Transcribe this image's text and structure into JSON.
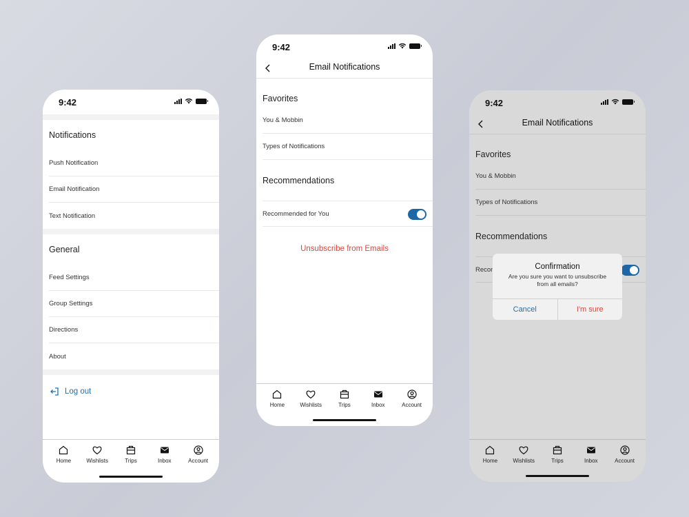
{
  "colors": {
    "accent": "#1d67a6",
    "danger": "#d6473d",
    "link": "#1e6fb0"
  },
  "status_time": "9:42",
  "tabs": [
    {
      "label": "Home",
      "icon": "home-icon"
    },
    {
      "label": "Wishlists",
      "icon": "heart-icon"
    },
    {
      "label": "Trips",
      "icon": "briefcase-icon"
    },
    {
      "label": "Inbox",
      "icon": "mail-icon"
    },
    {
      "label": "Account",
      "icon": "account-icon"
    }
  ],
  "settings": {
    "notifications_title": "Notifications",
    "notification_items": [
      "Push Notification",
      "Email Notification",
      "Text Notification"
    ],
    "general_title": "General",
    "general_items": [
      "Feed Settings",
      "Group Settings",
      "Directions",
      "About"
    ],
    "logout_label": "Log out"
  },
  "email": {
    "title": "Email Notifications",
    "favorites_title": "Favorites",
    "favorites_items": [
      "You & Mobbin",
      "Types of Notifications"
    ],
    "recommendations_title": "Recommendations",
    "recommended_label": "Recommended for You",
    "recommended_label_truncated": "Recom",
    "recommended_on": true,
    "unsubscribe_label": "Unsubscribe from Emails"
  },
  "dialog": {
    "title": "Confirmation",
    "message": "Are you sure you want to unsubscribe from all emails?",
    "cancel_label": "Cancel",
    "confirm_label": "I'm sure"
  }
}
